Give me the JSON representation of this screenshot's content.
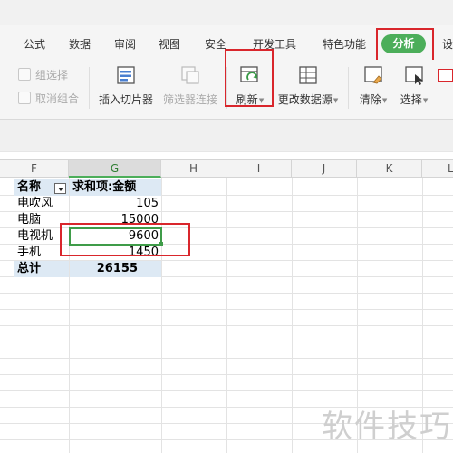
{
  "ribbon_tabs": [
    "公式",
    "数据",
    "审阅",
    "视图",
    "安全",
    "开发工具",
    "特色功能",
    "分析",
    "设"
  ],
  "active_tab": "分析",
  "accent_color": "#4cae5a",
  "highlight_color": "#d9262c",
  "commands": {
    "group_select": "组选择",
    "cancel_group": "取消组合",
    "insert_slicer": "插入切片器",
    "filter_connect": "筛选器连接",
    "refresh": "刷新",
    "change_source": "更改数据源",
    "clear": "清除",
    "select": "选择"
  },
  "sheet": {
    "columns": [
      "F",
      "G",
      "H",
      "I",
      "J",
      "K",
      "L"
    ],
    "selected_column": "G",
    "pivot": {
      "header_name": "名称",
      "header_value": "求和项:金额",
      "rows": [
        {
          "name": "电吹风",
          "value": "105"
        },
        {
          "name": "电脑",
          "value": "15000"
        },
        {
          "name": "电视机",
          "value": "9600"
        },
        {
          "name": "手机",
          "value": "1450"
        }
      ],
      "total_label": "总计",
      "total_value": "26155"
    }
  },
  "watermark": "软件技巧"
}
